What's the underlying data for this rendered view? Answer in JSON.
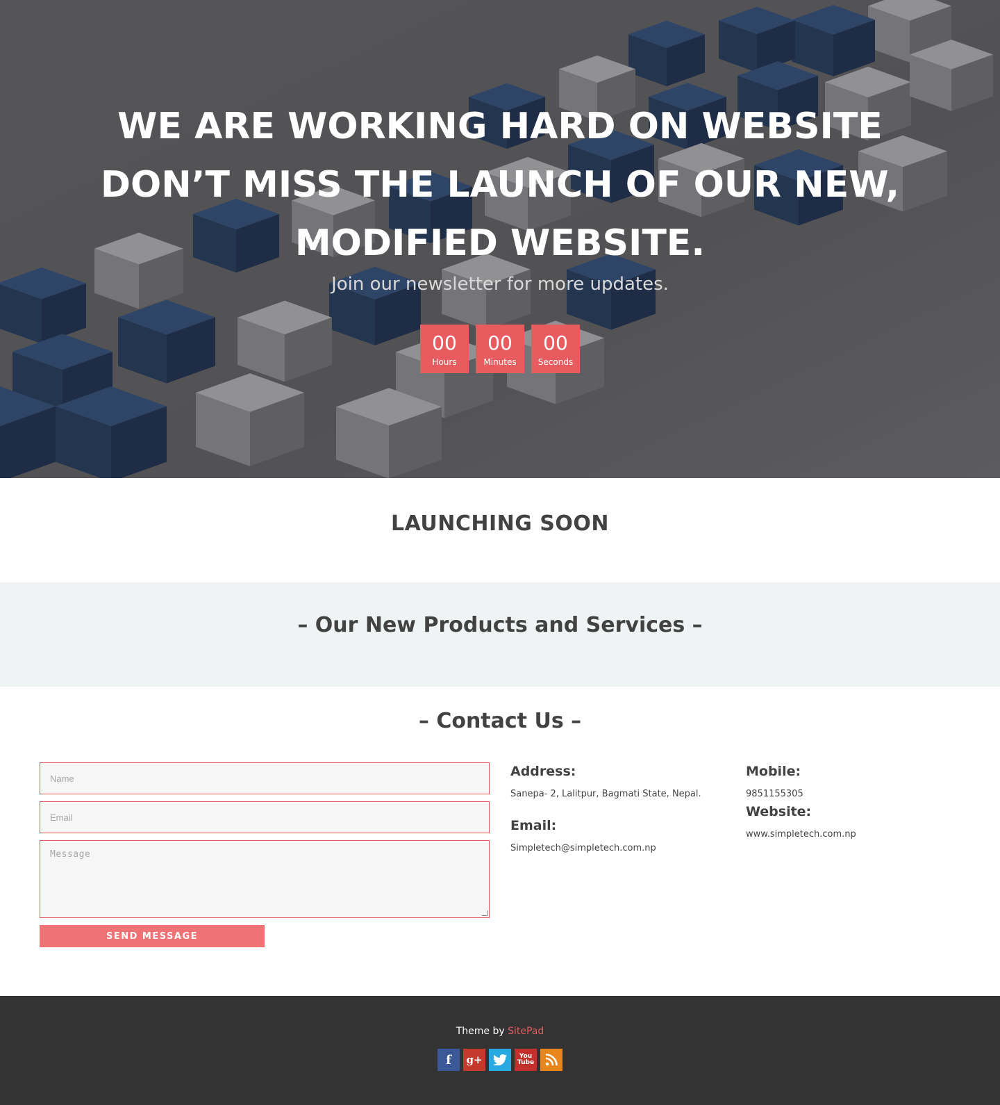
{
  "hero": {
    "title_lines": [
      "WE ARE WORKING HARD ON WEBSITE",
      "DON’T MISS THE LAUNCH OF OUR NEW,",
      "MODIFIED WEBSITE."
    ],
    "subtitle": "Join our newsletter for more updates.",
    "countdown": [
      {
        "value": "00",
        "label": "Hours"
      },
      {
        "value": "00",
        "label": "Minutes"
      },
      {
        "value": "00",
        "label": "Seconds"
      }
    ]
  },
  "launch": {
    "heading": "LAUNCHING SOON"
  },
  "products": {
    "heading": "– Our New Products and Services –"
  },
  "contact": {
    "heading": "– Contact Us –",
    "form": {
      "name_placeholder": "Name",
      "email_placeholder": "Email",
      "message_placeholder": "Message",
      "send_label": "SEND MESSAGE"
    },
    "address_label": "Address:",
    "address_value": "Sanepa- 2, Lalitpur, Bagmati State, Nepal.",
    "email_label": "Email:",
    "email_value": "Simpletech@simpletech.com.np",
    "mobile_label": "Mobile:",
    "mobile_value": "9851155305",
    "website_label": "Website:",
    "website_value": "www.simpletech.com.np"
  },
  "footer": {
    "credit_prefix": "Theme by",
    "credit_link": "SitePad",
    "social": [
      "facebook-icon",
      "google-plus-icon",
      "twitter-icon",
      "youtube-icon",
      "rss-icon"
    ]
  },
  "colors": {
    "accent": "#e85c5f",
    "button": "#ef7274",
    "footer_bg": "#333333",
    "products_bg": "#f0f3f4",
    "heading": "#424242"
  }
}
